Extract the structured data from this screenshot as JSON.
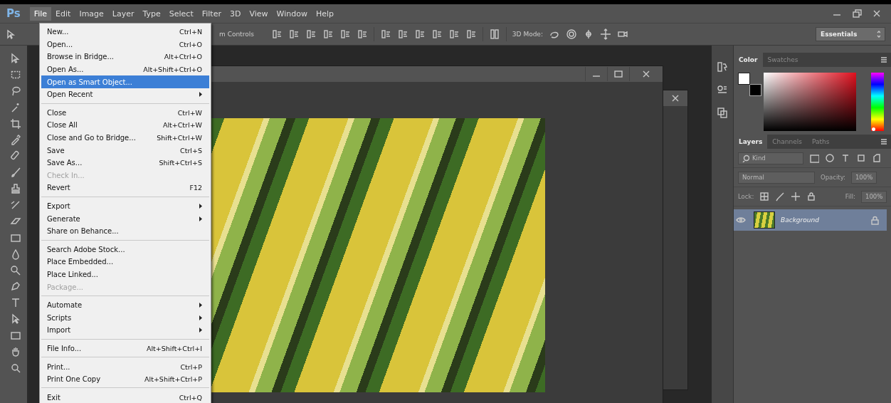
{
  "app": {
    "logo": "Ps"
  },
  "menu_bar": [
    {
      "label": "File",
      "selected": true
    },
    {
      "label": "Edit",
      "selected": false
    },
    {
      "label": "Image",
      "selected": false
    },
    {
      "label": "Layer",
      "selected": false
    },
    {
      "label": "Type",
      "selected": false
    },
    {
      "label": "Select",
      "selected": false
    },
    {
      "label": "Filter",
      "selected": false
    },
    {
      "label": "3D",
      "selected": false
    },
    {
      "label": "View",
      "selected": false
    },
    {
      "label": "Window",
      "selected": false
    },
    {
      "label": "Help",
      "selected": false
    }
  ],
  "options_bar": {
    "transform_label": "m Controls",
    "mode_label": "3D Mode:",
    "workspace": "Essentials"
  },
  "file_menu": [
    {
      "kind": "item",
      "label": "New...",
      "shortcut": "Ctrl+N",
      "disabled": false,
      "submenu": false,
      "selected": false
    },
    {
      "kind": "item",
      "label": "Open...",
      "shortcut": "Ctrl+O",
      "disabled": false,
      "submenu": false,
      "selected": false
    },
    {
      "kind": "item",
      "label": "Browse in Bridge...",
      "shortcut": "Alt+Ctrl+O",
      "disabled": false,
      "submenu": false,
      "selected": false
    },
    {
      "kind": "item",
      "label": "Open As...",
      "shortcut": "Alt+Shift+Ctrl+O",
      "disabled": false,
      "submenu": false,
      "selected": false
    },
    {
      "kind": "item",
      "label": "Open as Smart Object...",
      "disabled": false,
      "submenu": false,
      "selected": true
    },
    {
      "kind": "item",
      "label": "Open Recent",
      "disabled": false,
      "submenu": true,
      "selected": false
    },
    {
      "kind": "separator"
    },
    {
      "kind": "item",
      "label": "Close",
      "shortcut": "Ctrl+W",
      "disabled": false,
      "submenu": false,
      "selected": false
    },
    {
      "kind": "item",
      "label": "Close All",
      "shortcut": "Alt+Ctrl+W",
      "disabled": false,
      "submenu": false,
      "selected": false
    },
    {
      "kind": "item",
      "label": "Close and Go to Bridge...",
      "shortcut": "Shift+Ctrl+W",
      "disabled": false,
      "submenu": false,
      "selected": false
    },
    {
      "kind": "item",
      "label": "Save",
      "shortcut": "Ctrl+S",
      "disabled": false,
      "submenu": false,
      "selected": false
    },
    {
      "kind": "item",
      "label": "Save As...",
      "shortcut": "Shift+Ctrl+S",
      "disabled": false,
      "submenu": false,
      "selected": false
    },
    {
      "kind": "item",
      "label": "Check In...",
      "disabled": true,
      "submenu": false,
      "selected": false
    },
    {
      "kind": "item",
      "label": "Revert",
      "shortcut": "F12",
      "disabled": false,
      "submenu": false,
      "selected": false
    },
    {
      "kind": "separator"
    },
    {
      "kind": "item",
      "label": "Export",
      "disabled": false,
      "submenu": true,
      "selected": false
    },
    {
      "kind": "item",
      "label": "Generate",
      "disabled": false,
      "submenu": true,
      "selected": false
    },
    {
      "kind": "item",
      "label": "Share on Behance...",
      "disabled": false,
      "submenu": false,
      "selected": false
    },
    {
      "kind": "separator"
    },
    {
      "kind": "item",
      "label": "Search Adobe Stock...",
      "disabled": false,
      "submenu": false,
      "selected": false
    },
    {
      "kind": "item",
      "label": "Place Embedded...",
      "disabled": false,
      "submenu": false,
      "selected": false
    },
    {
      "kind": "item",
      "label": "Place Linked...",
      "disabled": false,
      "submenu": false,
      "selected": false
    },
    {
      "kind": "item",
      "label": "Package...",
      "disabled": true,
      "submenu": false,
      "selected": false
    },
    {
      "kind": "separator"
    },
    {
      "kind": "item",
      "label": "Automate",
      "disabled": false,
      "submenu": true,
      "selected": false
    },
    {
      "kind": "item",
      "label": "Scripts",
      "disabled": false,
      "submenu": true,
      "selected": false
    },
    {
      "kind": "item",
      "label": "Import",
      "disabled": false,
      "submenu": true,
      "selected": false
    },
    {
      "kind": "separator"
    },
    {
      "kind": "item",
      "label": "File Info...",
      "shortcut": "Alt+Shift+Ctrl+I",
      "disabled": false,
      "submenu": false,
      "selected": false
    },
    {
      "kind": "separator"
    },
    {
      "kind": "item",
      "label": "Print...",
      "shortcut": "Ctrl+P",
      "disabled": false,
      "submenu": false,
      "selected": false
    },
    {
      "kind": "item",
      "label": "Print One Copy",
      "shortcut": "Alt+Shift+Ctrl+P",
      "disabled": false,
      "submenu": false,
      "selected": false
    },
    {
      "kind": "separator"
    },
    {
      "kind": "item",
      "label": "Exit",
      "shortcut": "Ctrl+Q",
      "disabled": false,
      "submenu": false,
      "selected": false
    }
  ],
  "color_panel": {
    "tabs": [
      {
        "label": "Color",
        "selected": true
      },
      {
        "label": "Swatches",
        "selected": false
      }
    ],
    "hue_slider": {
      "level": 0
    }
  },
  "layers_panel": {
    "tabs": [
      {
        "label": "Layers",
        "selected": true
      },
      {
        "label": "Channels",
        "selected": false
      },
      {
        "label": "Paths",
        "selected": false
      }
    ],
    "filter": "Kind",
    "blend_mode": "Normal",
    "opacity_label": "Opacity:",
    "opacity": "100%",
    "lock_label": "Lock:",
    "fill_label": "Fill:",
    "fill": "100%",
    "layers": [
      {
        "name": "Background",
        "selected": true,
        "visible": true,
        "locked": true
      }
    ]
  }
}
